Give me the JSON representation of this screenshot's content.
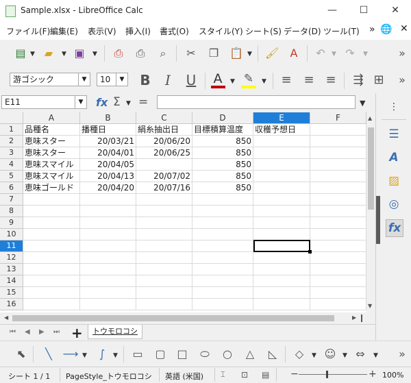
{
  "window": {
    "title": "Sample.xlsx - LibreOffice Calc",
    "minimize": "—",
    "maximize": "☐",
    "close": "✕"
  },
  "menu": [
    "ファイル(F)",
    "編集(E)",
    "表示(V)",
    "挿入(I)",
    "書式(O)",
    "スタイル(Y)",
    "シート(S)",
    "データ(D)",
    "ツール(T)"
  ],
  "menu_overflow": "»",
  "toolbar": {
    "font_name": "游ゴシック",
    "font_size": "10",
    "bold": "B",
    "italic": "I",
    "underline": "U",
    "font_color": "A",
    "overflow": "»"
  },
  "formula_bar": {
    "name_box": "E11",
    "fx": "fx",
    "sigma": "Σ",
    "equals": "=",
    "content": ""
  },
  "columns": [
    "A",
    "B",
    "C",
    "D",
    "E",
    "F"
  ],
  "selected_column": "E",
  "rows": [
    "1",
    "2",
    "3",
    "4",
    "5",
    "6",
    "7",
    "8",
    "9",
    "10",
    "11",
    "12",
    "13",
    "14",
    "15",
    "16"
  ],
  "selected_row": "11",
  "cells": {
    "header": [
      "品種名",
      "播種日",
      "絹糸抽出日",
      "目標積算温度",
      "収穫予想日"
    ],
    "data": [
      [
        "恵味スター",
        "20/03/21",
        "20/06/20",
        "850"
      ],
      [
        "恵味スター",
        "20/04/01",
        "20/06/25",
        "850"
      ],
      [
        "恵味スマイル",
        "20/04/05",
        "",
        "850"
      ],
      [
        "恵味スマイル",
        "20/04/13",
        "20/07/02",
        "850"
      ],
      [
        "恵味ゴールド",
        "20/04/20",
        "20/07/16",
        "850"
      ]
    ]
  },
  "sheet_tabs": {
    "add": "+",
    "active": "トウモロコシ"
  },
  "status": {
    "sheet": "シート 1 / 1",
    "page_style": "PageStyle_トウモロコシ",
    "language": "英語 (米国)",
    "zoom_minus": "−",
    "zoom_plus": "+",
    "zoom": "100%"
  },
  "colors": {
    "selection": "#1f7fd8",
    "font_color_bar": "#c00000",
    "highlight_bar": "#ffff00"
  }
}
